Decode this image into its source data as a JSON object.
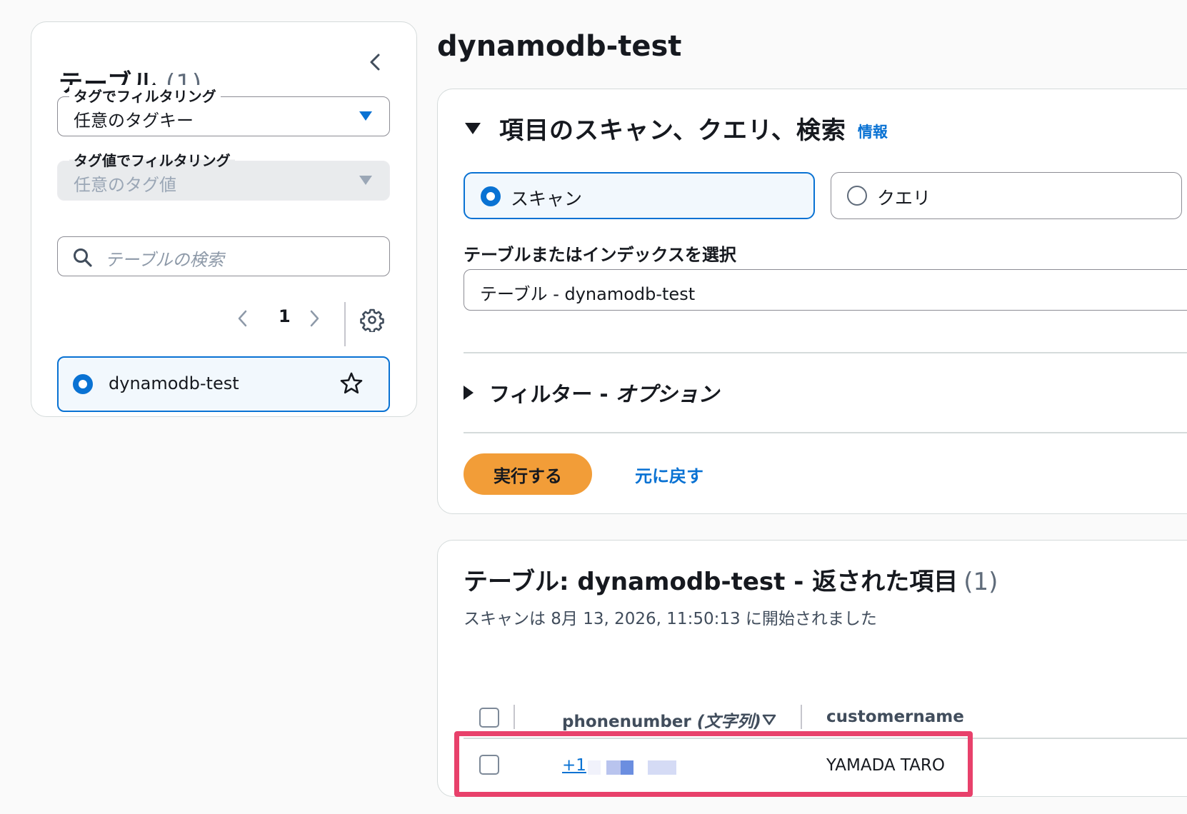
{
  "sidebar": {
    "title": "テーブル",
    "count": "(1)",
    "tag_filter": {
      "label": "タグでフィルタリング",
      "value": "任意のタグキー"
    },
    "tag_value_filter": {
      "label": "タグ値でフィルタリング",
      "value": "任意のタグ値"
    },
    "search": {
      "placeholder": "テーブルの検索"
    },
    "pagination": {
      "page": "1"
    },
    "tables": [
      {
        "name": "dynamodb-test",
        "selected": true
      }
    ]
  },
  "main": {
    "title": "dynamodb-test",
    "scan_panel": {
      "title": "項目のスキャン、クエリ、検索",
      "info_link": "情報",
      "modes": [
        {
          "label": "スキャン",
          "selected": true
        },
        {
          "label": "クエリ",
          "selected": false
        }
      ],
      "select_label": "テーブルまたはインデックスを選択",
      "select_value": "テーブル - dynamodb-test",
      "filter_label": "フィルター - ",
      "filter_option": "オプション",
      "run_button": "実行する",
      "reset_link": "元に戻す"
    },
    "results_panel": {
      "title": "テーブル: dynamodb-test - 返された項目",
      "count": "(1)",
      "subtitle": "スキャンは 8月 13, 2026, 11:50:13 に開始されました",
      "columns": [
        {
          "name": "phonenumber",
          "type": "(文字列)"
        },
        {
          "name": "customername"
        }
      ],
      "rows": [
        {
          "phonenumber": "+1",
          "customername": "YAMADA TARO"
        }
      ]
    }
  },
  "colors": {
    "accent": "#0972d3",
    "run_button": "#f29d38",
    "highlight": "#e8416b"
  },
  "icons": [
    "chevron-left-icon",
    "caret-down-icon",
    "search-icon",
    "chevron-right-icon",
    "gear-icon",
    "star-icon",
    "sort-icon"
  ]
}
